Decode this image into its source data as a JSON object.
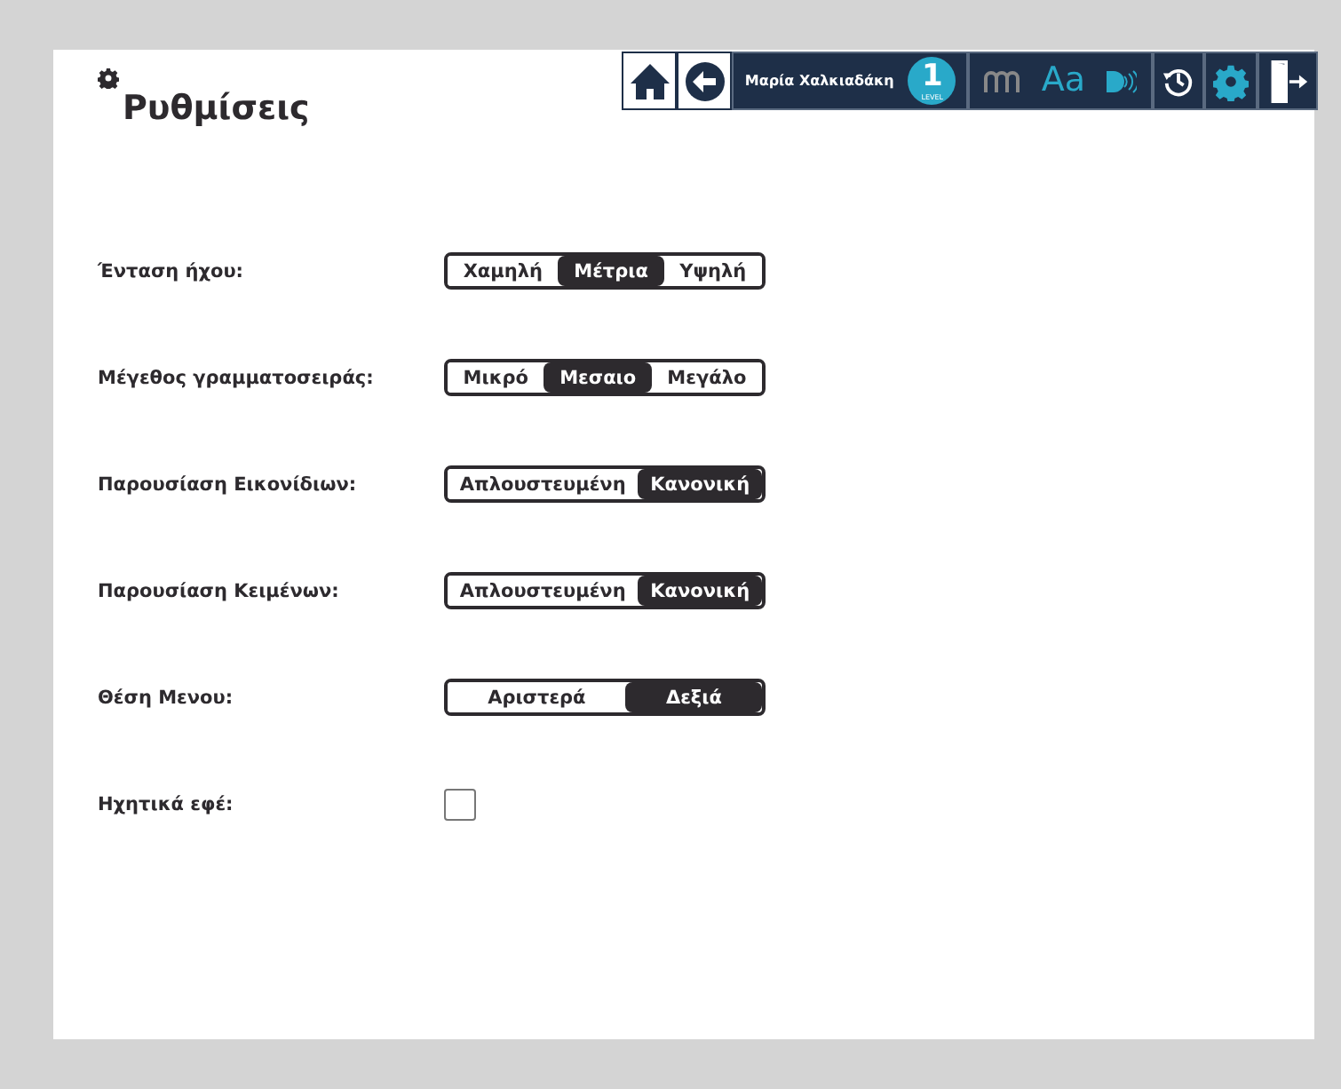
{
  "title": "Ρυθμίσεις",
  "toolbar": {
    "user_name": "Μαρία Χαλκιαδάκη",
    "level": "1",
    "level_caption": "LEVEL",
    "font_label": "Aa"
  },
  "settings": [
    {
      "kind": "segmented",
      "label": "Ένταση ήχου:",
      "options": [
        {
          "label": "Χαμηλή",
          "selected": false
        },
        {
          "label": "Μέτρια",
          "selected": true
        },
        {
          "label": "Υψηλή",
          "selected": false
        }
      ]
    },
    {
      "kind": "segmented",
      "label": "Μέγεθος γραμματοσειράς:",
      "options": [
        {
          "label": "Μικρό",
          "selected": false
        },
        {
          "label": "Μεσαιο",
          "selected": true
        },
        {
          "label": "Μεγάλο",
          "selected": false
        }
      ]
    },
    {
      "kind": "segmented",
      "label": "Παρουσίαση Εικονίδιων:",
      "options": [
        {
          "label": "Απλουστευμένη",
          "selected": false
        },
        {
          "label": "Κανονική",
          "selected": true
        }
      ]
    },
    {
      "kind": "segmented",
      "label": "Παρουσίαση Κειμένων:",
      "options": [
        {
          "label": "Απλουστευμένη",
          "selected": false
        },
        {
          "label": "Κανονική",
          "selected": true
        }
      ]
    },
    {
      "kind": "segmented",
      "label": "Θέση Μενου:",
      "options": [
        {
          "label": "Αριστερά",
          "selected": false
        },
        {
          "label": "Δεξιά",
          "selected": true
        }
      ]
    },
    {
      "kind": "checkbox",
      "label": "Ηχητικά εφέ:",
      "checked": false
    }
  ]
}
